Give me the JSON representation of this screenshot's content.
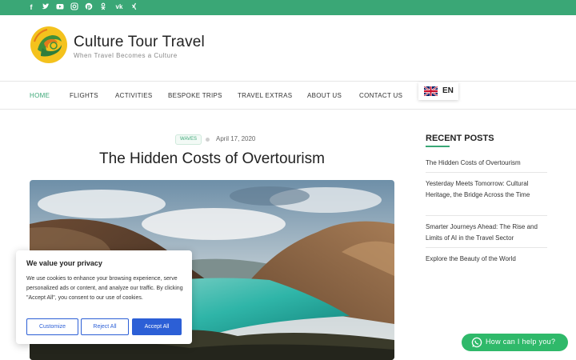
{
  "topbar": {
    "social_icons": [
      "facebook-icon",
      "twitter-icon",
      "youtube-icon",
      "instagram-icon",
      "pinterest-icon",
      "odnoklassniki-icon",
      "vk-icon",
      "xing-icon"
    ],
    "accent_color": "#3aa776"
  },
  "header": {
    "title": "Culture Tour Travel",
    "tagline": "When Travel Becomes a Culture"
  },
  "nav": {
    "items": [
      "HOME",
      "FLIGHTS",
      "ACTIVITIES",
      "BESPOKE TRIPS",
      "TRAVEL EXTRAS",
      "ABOUT US",
      "CONTACT US"
    ],
    "active": "HOME",
    "language": "EN",
    "language_flag": "uk-flag-icon"
  },
  "post": {
    "tag": "WAVES",
    "date": "April 17, 2020",
    "title": "The Hidden Costs of Overtourism",
    "image": "fjord-landscape-image"
  },
  "sidebar": {
    "title": "RECENT POSTS",
    "posts": [
      "The Hidden Costs of Overtourism",
      " Yesterday Meets Tomorrow: Cultural Heritage, the Bridge Across the Time",
      " Smarter Journeys Ahead: The Rise and Limits of AI in the Travel Sector",
      "Explore the Beauty of the World"
    ]
  },
  "cookie": {
    "title": "We value your privacy",
    "text": "We use cookies to enhance your browsing experience, serve personalized ads or content, and analyze our traffic. By clicking \"Accept All\", you consent to our use of cookies.",
    "customize": "Customize",
    "reject": "Reject All",
    "accept": "Accept All",
    "button_color": "#2c5fd6"
  },
  "help": {
    "label": "How can I help you?",
    "color": "#2fb96a"
  }
}
